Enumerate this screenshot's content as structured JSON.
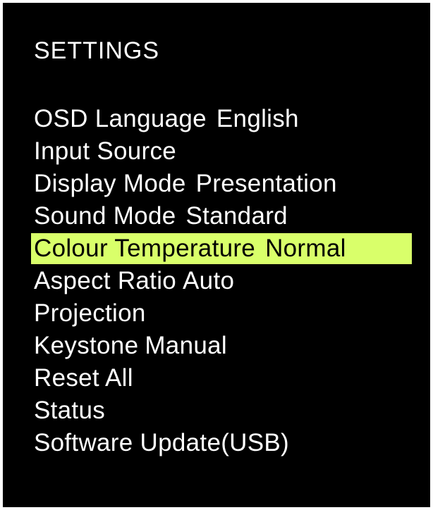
{
  "title": "SETTINGS",
  "colors": {
    "background": "#000000",
    "text": "#ffffff",
    "highlight_bg": "#d9ff6a",
    "highlight_text": "#000000"
  },
  "menu": {
    "items": [
      {
        "label": "OSD Language",
        "value": "English",
        "selected": false
      },
      {
        "label": "Input Source",
        "value": "",
        "selected": false
      },
      {
        "label": "Display Mode",
        "value": "Presentation",
        "selected": false
      },
      {
        "label": "Sound Mode",
        "value": "Standard",
        "selected": false
      },
      {
        "label": "Colour Temperature",
        "value": "Normal",
        "selected": true
      },
      {
        "label": "Aspect Ratio",
        "value": "Auto",
        "selected": false
      },
      {
        "label": "Projection",
        "value": "",
        "selected": false
      },
      {
        "label": "Keystone",
        "value": "Manual",
        "selected": false
      },
      {
        "label": "Reset All",
        "value": "",
        "selected": false
      },
      {
        "label": "Status",
        "value": "",
        "selected": false
      },
      {
        "label": "Software Update(USB)",
        "value": "",
        "selected": false
      }
    ]
  }
}
